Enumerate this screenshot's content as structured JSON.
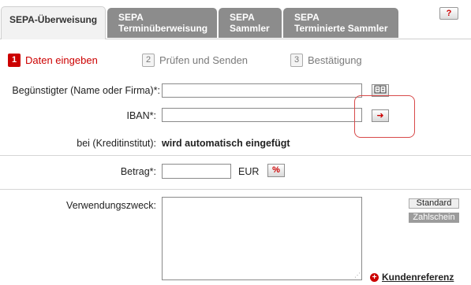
{
  "tabs": [
    {
      "line1": "SEPA-Überweisung",
      "line2": ""
    },
    {
      "line1": "SEPA",
      "line2": "Terminüberweisung"
    },
    {
      "line1": "SEPA",
      "line2": "Sammler"
    },
    {
      "line1": "SEPA",
      "line2": "Terminierte Sammler"
    }
  ],
  "help": {
    "label": "?"
  },
  "steps": [
    {
      "num": "1",
      "label": "Daten eingeben"
    },
    {
      "num": "2",
      "label": "Prüfen und Senden"
    },
    {
      "num": "3",
      "label": "Bestätigung"
    }
  ],
  "form": {
    "beguenstigter_label": "Begünstigter (Name oder Firma)*:",
    "beguenstigter_value": "",
    "iban_label": "IBAN*:",
    "iban_value": "",
    "bank_label": "bei (Kreditinstitut):",
    "bank_value": "wird automatisch eingefügt",
    "betrag_label": "Betrag*:",
    "betrag_value": "",
    "currency": "EUR",
    "verwendungszweck_label": "Verwendungszweck:",
    "verwendungszweck_value": ""
  },
  "buttons": {
    "standard": "Standard",
    "zahlschein": "Zahlschein",
    "kundenreferenz": "Kundenreferenz",
    "iban_go": "➜",
    "calc": "%"
  },
  "icons": {
    "address_book": "address-book-icon",
    "arrow": "arrow-right-icon",
    "calculator": "calculator-icon",
    "plus": "plus-icon"
  },
  "colors": {
    "accent": "#cc0000",
    "tab_inactive": "#8c8c8c"
  }
}
